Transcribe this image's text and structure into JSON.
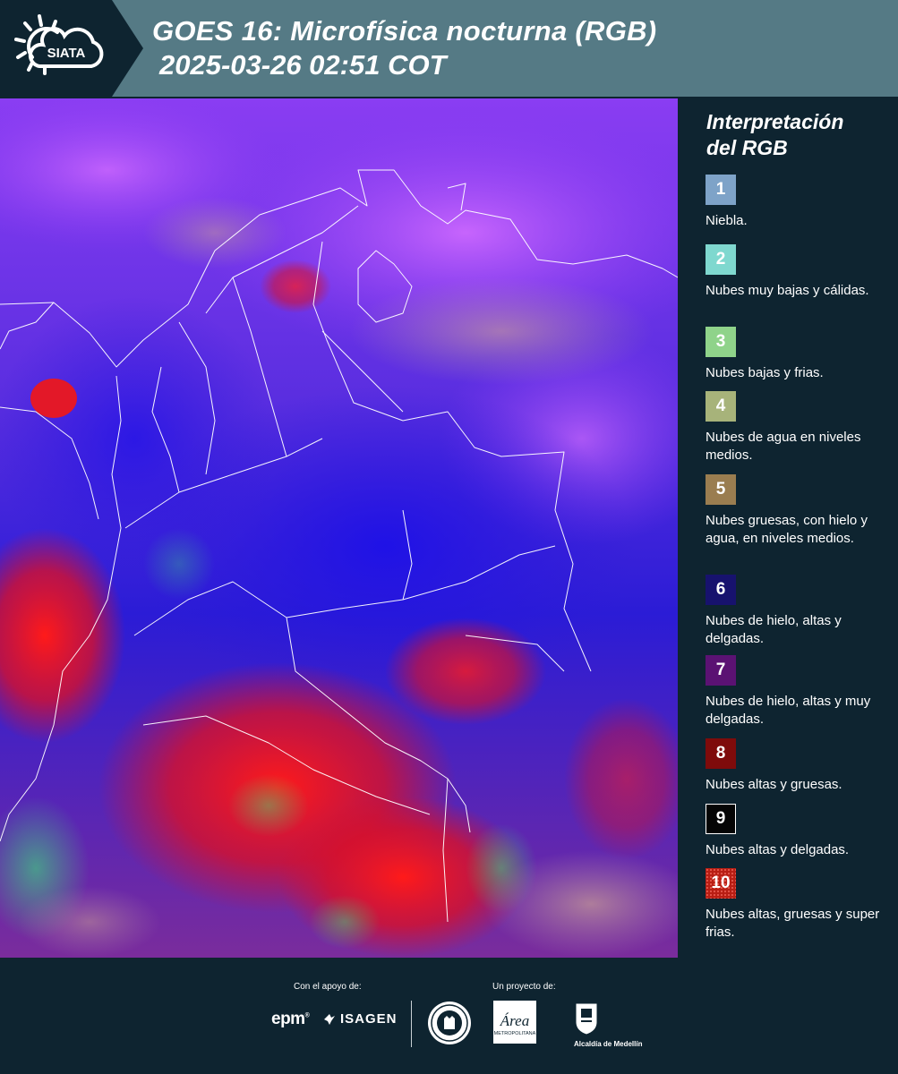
{
  "header": {
    "logo_text": "SIATA",
    "title": "GOES 16: Microfísica nocturna (RGB)",
    "subtitle": "2025-03-26 02:51 COT"
  },
  "legend": {
    "title_line1": "Interpretación",
    "title_line2": "del RGB",
    "items": [
      {
        "num": "1",
        "label": "Niebla.",
        "color": "#7ea3c8"
      },
      {
        "num": "2",
        "label": "Nubes muy bajas y cálidas.",
        "color": "#7fd8cf"
      },
      {
        "num": "3",
        "label": "Nubes bajas y frias.",
        "color": "#8fd38a"
      },
      {
        "num": "4",
        "label": "Nubes de agua en niveles medios.",
        "color": "#a7b37a"
      },
      {
        "num": "5",
        "label": "Nubes gruesas, con hielo y agua, en niveles medios.",
        "color": "#9a7d50"
      },
      {
        "num": "6",
        "label": "Nubes de hielo, altas y delgadas.",
        "color": "#17126e"
      },
      {
        "num": "7",
        "label": "Nubes de hielo, altas y muy delgadas.",
        "color": "#5b1273"
      },
      {
        "num": "8",
        "label": "Nubes altas y gruesas.",
        "color": "#7e0b0b"
      },
      {
        "num": "9",
        "label": "Nubes altas y delgadas.",
        "color": "#050505"
      },
      {
        "num": "10",
        "label": "Nubes altas, gruesas y super frias.",
        "color": "#b81e14"
      }
    ]
  },
  "footer": {
    "support_label": "Con el apoyo de:",
    "project_label": "Un proyecto de:",
    "epm": "epm",
    "isagen": "ISAGEN",
    "area_logo_text": "Área",
    "area_subtitle": "METROPOLITANA",
    "alcaldia": "Alcaldía de Medellín"
  },
  "colors": {
    "header_bg": "#557a85",
    "panel_bg": "#0e2430"
  }
}
